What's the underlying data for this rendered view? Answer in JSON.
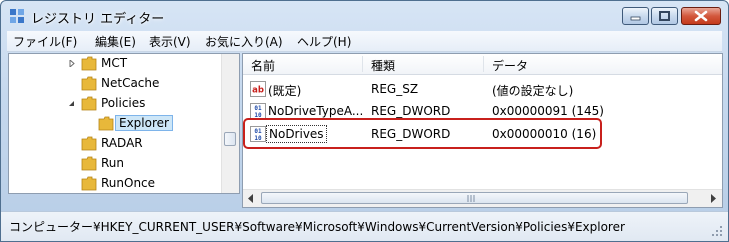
{
  "window": {
    "title": "レジストリ エディター"
  },
  "menu": [
    "ファイル(F)",
    "編集(E)",
    "表示(V)",
    "お気に入り(A)",
    "ヘルプ(H)"
  ],
  "tree": {
    "items": [
      {
        "label": "MCT",
        "expander": "collapsed"
      },
      {
        "label": "NetCache",
        "expander": "none"
      },
      {
        "label": "Policies",
        "expander": "expanded"
      },
      {
        "label": "Explorer",
        "expander": "none",
        "selected": true
      },
      {
        "label": "RADAR",
        "expander": "none"
      },
      {
        "label": "Run",
        "expander": "none"
      },
      {
        "label": "RunOnce",
        "expander": "none"
      }
    ]
  },
  "list": {
    "columns": [
      "名前",
      "種類",
      "データ"
    ],
    "rows": [
      {
        "name": "(既定)",
        "type": "REG_SZ",
        "data": "(値の設定なし)",
        "icon": "string-value-icon"
      },
      {
        "name": "NoDriveTypeA...",
        "type": "REG_DWORD",
        "data": "0x00000091 (145)",
        "icon": "binary-value-icon"
      },
      {
        "name": "NoDrives",
        "type": "REG_DWORD",
        "data": "0x00000010 (16)",
        "icon": "binary-value-icon",
        "focused": true
      }
    ]
  },
  "status": {
    "path": "コンピューター¥HKEY_CURRENT_USER¥Software¥Microsoft¥Windows¥CurrentVersion¥Policies¥Explorer"
  },
  "colors": {
    "highlight_border": "#c8201c",
    "selection": "#cde6f7",
    "folder": "#e8b83a"
  }
}
